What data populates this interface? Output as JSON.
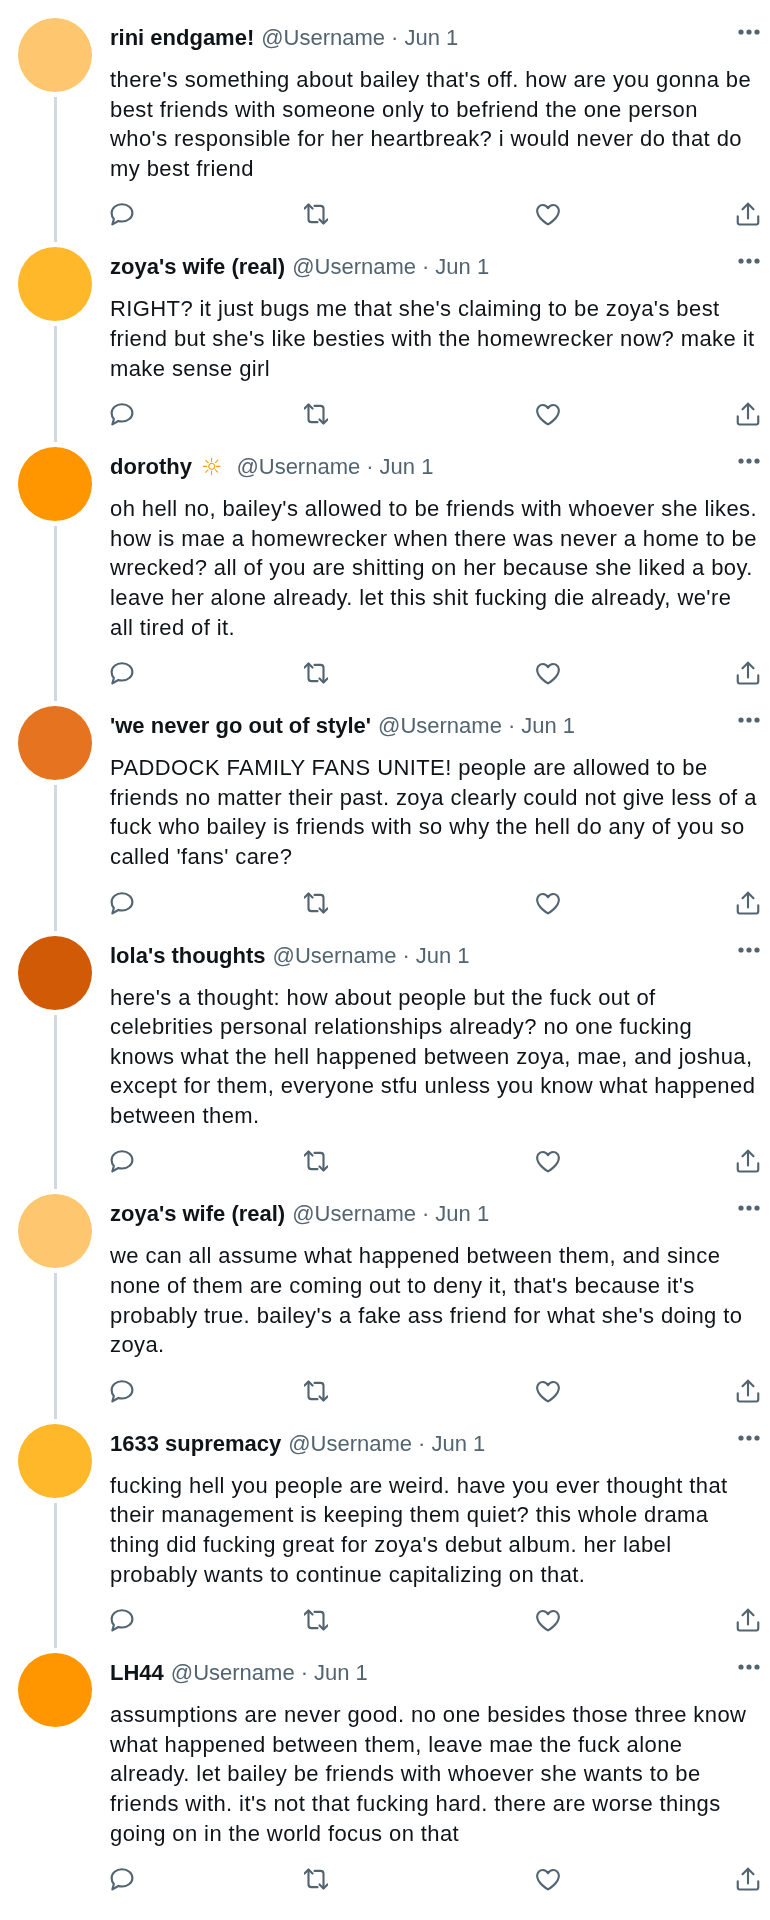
{
  "tweets": [
    {
      "display_name": "rini endgame!",
      "handle": "@Username",
      "separator": "·",
      "date": "Jun 1",
      "color": "#fec76f",
      "connected": true,
      "text": "there's something about bailey that's off. how are you gonna be best friends with someone only to befriend the one person who's responsible for her heartbreak? i would never do that do my best friend"
    },
    {
      "display_name": "zoya's wife (real)",
      "handle": "@Username",
      "separator": "·",
      "date": "Jun 1",
      "color": "#ffb829",
      "connected": true,
      "text": "RIGHT? it just bugs me that she's claiming to be zoya's best friend but she's like besties with the homewrecker now? make it make sense girl"
    },
    {
      "display_name": "dorothy",
      "name_emoji": "☼",
      "handle": "@Username",
      "separator": "·",
      "date": "Jun 1",
      "color": "#ff9600",
      "connected": true,
      "text": "oh hell no, bailey's allowed to be friends with whoever she likes. how is mae a homewrecker when there was never a home to be wrecked? all of you are shitting on her because she liked a boy. leave her alone already. let this shit fucking die already, we're all tired of it."
    },
    {
      "display_name": "'we never go out of style'",
      "handle": "@Username",
      "separator": "·",
      "date": "Jun 1",
      "color": "#e5731f",
      "connected": true,
      "text": "PADDOCK FAMILY FANS UNITE! people are allowed to be friends no matter their past. zoya clearly could not give less of a fuck who bailey is friends with so why the hell do any of you so called 'fans' care?"
    },
    {
      "display_name": "lola's thoughts",
      "handle": "@Username",
      "separator": "·",
      "date": "Jun 1",
      "color": "#d05a05",
      "connected": true,
      "text": "here's a thought: how about people but the fuck out of celebrities personal relationships already? no one fucking knows what the hell happened between zoya, mae, and joshua, except for them, everyone stfu unless you know what happened between them."
    },
    {
      "display_name": "zoya's wife (real)",
      "handle": "@Username",
      "separator": "·",
      "date": "Jun 1",
      "color": "#fec76f",
      "connected": true,
      "text": "we can all assume what happened between them, and since none of them are coming out to deny it, that's because it's probably true. bailey's a fake ass friend for what she's doing to zoya."
    },
    {
      "display_name": "1633 supremacy",
      "handle": "@Username",
      "separator": "·",
      "date": "Jun 1",
      "color": "#ffb829",
      "connected": true,
      "text": "fucking hell you people are weird. have you ever thought that their management is keeping them quiet? this whole drama thing did fucking great for zoya's debut album. her label probably wants to continue capitalizing on that."
    },
    {
      "display_name": "LH44",
      "handle": "@Username",
      "separator": "·",
      "date": "Jun 1",
      "color": "#ff9600",
      "connected": false,
      "text": "assumptions are never good. no one besides those three know what happened between them, leave mae the fuck alone already. let bailey be friends with whoever she wants to be friends with. it's not that fucking hard. there are worse things going on in the world focus on that"
    }
  ]
}
